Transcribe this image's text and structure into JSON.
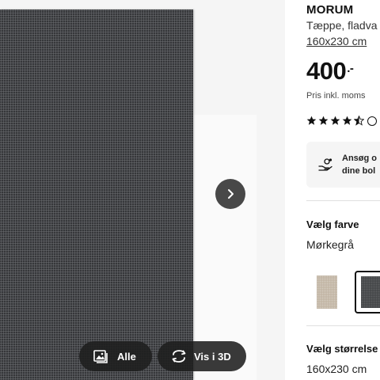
{
  "gallery": {
    "next_icon": "chevron-right-icon",
    "all_button": {
      "label": "Alle",
      "icon": "image-gallery-icon"
    },
    "view_3d_button": {
      "label": "Vis i 3D",
      "icon": "rotate-3d-icon"
    }
  },
  "product": {
    "brand": "MORUM",
    "subtitle": "Tæppe, fladva",
    "size_link": "160x230 cm",
    "price_main": "400",
    "price_suffix": ".-",
    "price_note": "Pris inkl. moms",
    "rating": {
      "stars_full": 4,
      "stars_half": 1,
      "max": 5
    }
  },
  "finance": {
    "icon": "hand-money-icon",
    "line1": "Ansøg o",
    "line2": "dine bol"
  },
  "color": {
    "label": "Vælg farve",
    "selected": "Mørkegrå",
    "swatches": [
      {
        "name": "beige",
        "color": "#c3b7a6",
        "selected": false
      },
      {
        "name": "mørkegrå",
        "color": "#46484b",
        "selected": true
      }
    ]
  },
  "size": {
    "label": "Vælg størrelse",
    "selected": "160x230 cm"
  },
  "colors": {
    "text": "#111111",
    "pill_bg": "#1e1e1e",
    "divider": "#dfdfdf"
  }
}
